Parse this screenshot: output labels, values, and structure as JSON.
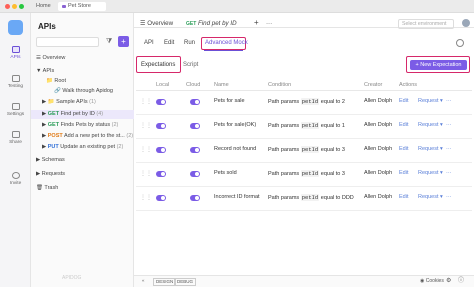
{
  "titlebar": {
    "home_label": "Home",
    "project_tab": "Pet Store"
  },
  "rail": {
    "items": [
      {
        "label": "APIs",
        "active": true
      },
      {
        "label": "Testing",
        "active": false
      },
      {
        "label": "Settings",
        "active": false
      },
      {
        "label": "Share",
        "active": false
      },
      {
        "label": "Invite",
        "active": false
      }
    ]
  },
  "tree": {
    "title": "APIs",
    "overview": "Overview",
    "apis_label": "APIs",
    "root": "Root",
    "walkthrough": "Walk through Apidog",
    "sample_apis": "Sample APIs",
    "sample_count": "(1)",
    "endpoints": [
      {
        "method": "GET",
        "name": "Find pet by ID",
        "count": "(4)"
      },
      {
        "method": "GET",
        "name": "Finds Pets by status",
        "count": "(2)"
      },
      {
        "method": "POST",
        "name": "Add a new pet to the st...",
        "count": "(2)"
      },
      {
        "method": "PUT",
        "name": "Update an existing pet",
        "count": "(2)"
      }
    ],
    "schemas": "Schemas",
    "requests": "Requests",
    "trash": "Trash",
    "footer": "APIDOG"
  },
  "main": {
    "overview_tab": "Overview",
    "active_tab_method": "GET",
    "active_tab_name": "Find pet by ID",
    "env_placeholder": "Select environment",
    "subtabs": {
      "api": "API",
      "edit": "Edit",
      "run": "Run",
      "advanced_mock": "Advanced Mock"
    },
    "exp_tabs": {
      "expectations": "Expectations",
      "script": "Script"
    },
    "new_expectation": "+ New Expectation",
    "columns": [
      "Local",
      "Cloud",
      "Name",
      "Condition",
      "Creator",
      "Actions"
    ],
    "rows": [
      {
        "name": "Pets for sale",
        "cond_a": "Path params",
        "cond_field": "petId",
        "cond_b": "equal to 2",
        "creator": "Allen Dolph",
        "action1": "Edit",
        "action2": "Request"
      },
      {
        "name": "Pets for sale(OK)",
        "cond_a": "Path params",
        "cond_field": "petId",
        "cond_b": "equal to 1",
        "creator": "Allen Dolph",
        "action1": "Edit",
        "action2": "Request"
      },
      {
        "name": "Record not found",
        "cond_a": "Path params",
        "cond_field": "petId",
        "cond_b": "equal to 3",
        "creator": "Allen Dolph",
        "action1": "Edit",
        "action2": "Request"
      },
      {
        "name": "Pets sold",
        "cond_a": "Path params",
        "cond_field": "petId",
        "cond_b": "equal to 3",
        "creator": "Allen Dolph",
        "action1": "Edit",
        "action2": "Request"
      },
      {
        "name": "Incorrect ID format",
        "cond_a": "Path params",
        "cond_field": "petId",
        "cond_b": "equal to DDD",
        "creator": "Allen Dolph",
        "action1": "Edit",
        "action2": "Request"
      }
    ],
    "footer": {
      "design": "DESIGN",
      "debug": "DEBUG",
      "cookies": "Cookies"
    }
  },
  "colors": {
    "accent": "#7b5ce6",
    "highlight_box": "#d6286a",
    "get": "#2e9e5b",
    "post": "#e07b17",
    "put": "#2f6fd8"
  }
}
